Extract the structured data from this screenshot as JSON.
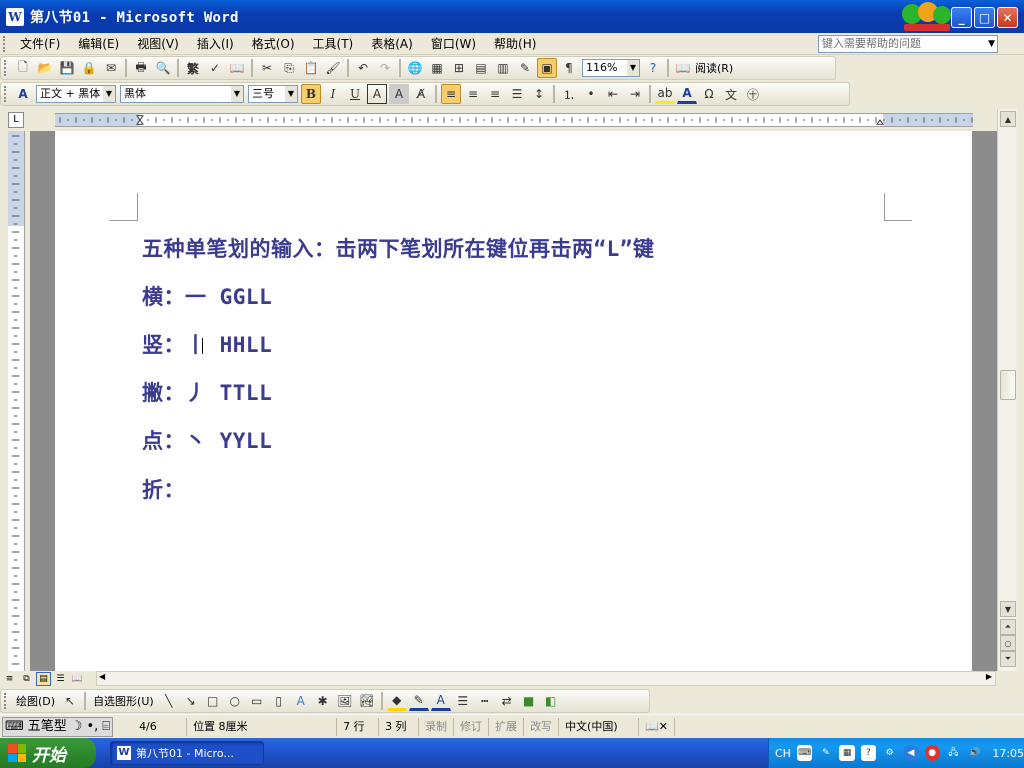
{
  "window": {
    "title": "第八节01 - Microsoft Word",
    "icon_label": "W"
  },
  "menubar": {
    "items": [
      "文件(F)",
      "编辑(E)",
      "视图(V)",
      "插入(I)",
      "格式(O)",
      "工具(T)",
      "表格(A)",
      "窗口(W)",
      "帮助(H)"
    ],
    "help_placeholder": "键入需要帮助的问题"
  },
  "toolbar": {
    "zoom": "116%",
    "read_label": "阅读(R)"
  },
  "formatting": {
    "style": "正文 + 黑体",
    "font": "黑体",
    "size": "三号"
  },
  "document": {
    "lines": [
      "五种单笔划的输入：击两下笔划所在键位再击两“L”键",
      "横：一 GGLL",
      "竖：丨 HHLL",
      "撇：丿 TTLL",
      "点：丶 YYLL",
      "折："
    ]
  },
  "drawing_toolbar": {
    "draw_label": "绘图(D)",
    "autoshape_label": "自选图形(U)"
  },
  "statusbar": {
    "ime_name": "五笔型",
    "page": "4/6",
    "position": "位置 8厘米",
    "line": "7 行",
    "col": "3 列",
    "rec": "录制",
    "trk": "修订",
    "ext": "扩展",
    "ovr": "改写",
    "language": "中文(中国)"
  },
  "taskbar": {
    "start_label": "开始",
    "task_label": "第八节01 - Micro...",
    "tray_lang": "CH",
    "time": "17:05"
  }
}
